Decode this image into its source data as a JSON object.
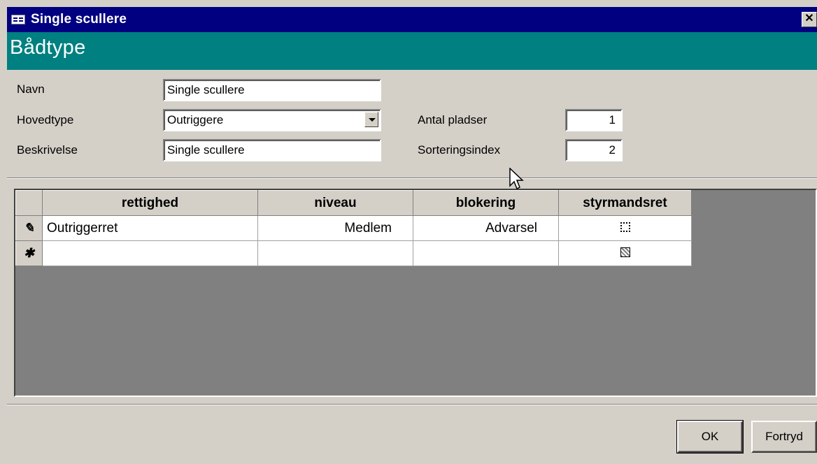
{
  "window": {
    "title": "Single scullere",
    "icon": "form-icon",
    "close": "✕"
  },
  "header": {
    "heading": "Bådtype"
  },
  "form": {
    "navn": {
      "label": "Navn",
      "value": "Single scullere"
    },
    "hovedtype": {
      "label": "Hovedtype",
      "value": "Outriggere"
    },
    "beskrivelse": {
      "label": "Beskrivelse",
      "value": "Single scullere"
    },
    "antal_pladser": {
      "label": "Antal pladser",
      "value": "1"
    },
    "sorteringsindex": {
      "label": "Sorteringsindex",
      "value": "2"
    }
  },
  "datasheet": {
    "columns": [
      "rettighed",
      "niveau",
      "blokering",
      "styrmandsret"
    ],
    "rows": [
      {
        "selector": "✎",
        "rettighed": "Outriggerret",
        "niveau": "Medlem",
        "blokering": "Advarsel",
        "styrmandsret": "unchecked"
      },
      {
        "selector": "✱",
        "rettighed": "",
        "niveau": "",
        "blokering": "",
        "styrmandsret": "null"
      }
    ]
  },
  "buttons": {
    "ok": "OK",
    "cancel": "Fortryd"
  },
  "colors": {
    "titlebar": "#000080",
    "header": "#008080",
    "face": "#d4d0c8",
    "grid_bg": "#808080"
  }
}
